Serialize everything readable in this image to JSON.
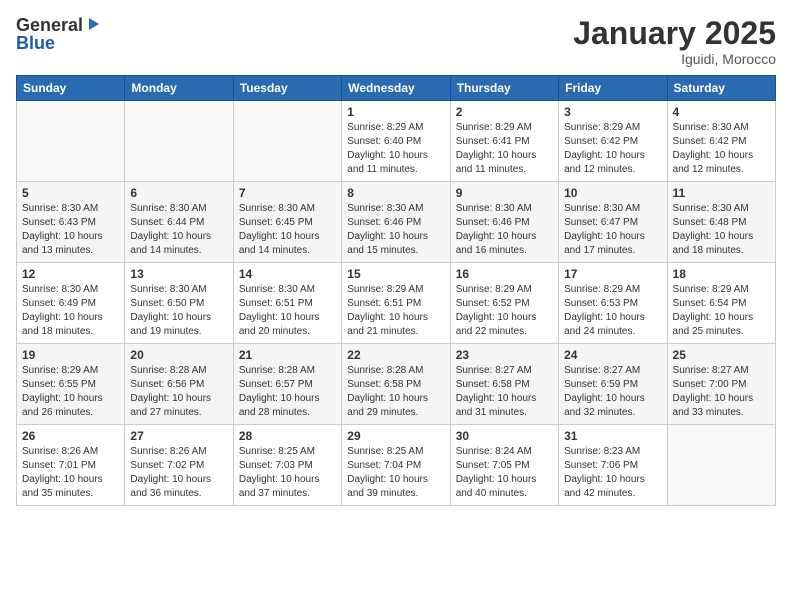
{
  "logo": {
    "general": "General",
    "blue": "Blue"
  },
  "title": {
    "month": "January 2025",
    "location": "Iguidi, Morocco"
  },
  "weekdays": [
    "Sunday",
    "Monday",
    "Tuesday",
    "Wednesday",
    "Thursday",
    "Friday",
    "Saturday"
  ],
  "weeks": [
    [
      {
        "day": "",
        "info": ""
      },
      {
        "day": "",
        "info": ""
      },
      {
        "day": "",
        "info": ""
      },
      {
        "day": "1",
        "info": "Sunrise: 8:29 AM\nSunset: 6:40 PM\nDaylight: 10 hours\nand 11 minutes."
      },
      {
        "day": "2",
        "info": "Sunrise: 8:29 AM\nSunset: 6:41 PM\nDaylight: 10 hours\nand 11 minutes."
      },
      {
        "day": "3",
        "info": "Sunrise: 8:29 AM\nSunset: 6:42 PM\nDaylight: 10 hours\nand 12 minutes."
      },
      {
        "day": "4",
        "info": "Sunrise: 8:30 AM\nSunset: 6:42 PM\nDaylight: 10 hours\nand 12 minutes."
      }
    ],
    [
      {
        "day": "5",
        "info": "Sunrise: 8:30 AM\nSunset: 6:43 PM\nDaylight: 10 hours\nand 13 minutes."
      },
      {
        "day": "6",
        "info": "Sunrise: 8:30 AM\nSunset: 6:44 PM\nDaylight: 10 hours\nand 14 minutes."
      },
      {
        "day": "7",
        "info": "Sunrise: 8:30 AM\nSunset: 6:45 PM\nDaylight: 10 hours\nand 14 minutes."
      },
      {
        "day": "8",
        "info": "Sunrise: 8:30 AM\nSunset: 6:46 PM\nDaylight: 10 hours\nand 15 minutes."
      },
      {
        "day": "9",
        "info": "Sunrise: 8:30 AM\nSunset: 6:46 PM\nDaylight: 10 hours\nand 16 minutes."
      },
      {
        "day": "10",
        "info": "Sunrise: 8:30 AM\nSunset: 6:47 PM\nDaylight: 10 hours\nand 17 minutes."
      },
      {
        "day": "11",
        "info": "Sunrise: 8:30 AM\nSunset: 6:48 PM\nDaylight: 10 hours\nand 18 minutes."
      }
    ],
    [
      {
        "day": "12",
        "info": "Sunrise: 8:30 AM\nSunset: 6:49 PM\nDaylight: 10 hours\nand 18 minutes."
      },
      {
        "day": "13",
        "info": "Sunrise: 8:30 AM\nSunset: 6:50 PM\nDaylight: 10 hours\nand 19 minutes."
      },
      {
        "day": "14",
        "info": "Sunrise: 8:30 AM\nSunset: 6:51 PM\nDaylight: 10 hours\nand 20 minutes."
      },
      {
        "day": "15",
        "info": "Sunrise: 8:29 AM\nSunset: 6:51 PM\nDaylight: 10 hours\nand 21 minutes."
      },
      {
        "day": "16",
        "info": "Sunrise: 8:29 AM\nSunset: 6:52 PM\nDaylight: 10 hours\nand 22 minutes."
      },
      {
        "day": "17",
        "info": "Sunrise: 8:29 AM\nSunset: 6:53 PM\nDaylight: 10 hours\nand 24 minutes."
      },
      {
        "day": "18",
        "info": "Sunrise: 8:29 AM\nSunset: 6:54 PM\nDaylight: 10 hours\nand 25 minutes."
      }
    ],
    [
      {
        "day": "19",
        "info": "Sunrise: 8:29 AM\nSunset: 6:55 PM\nDaylight: 10 hours\nand 26 minutes."
      },
      {
        "day": "20",
        "info": "Sunrise: 8:28 AM\nSunset: 6:56 PM\nDaylight: 10 hours\nand 27 minutes."
      },
      {
        "day": "21",
        "info": "Sunrise: 8:28 AM\nSunset: 6:57 PM\nDaylight: 10 hours\nand 28 minutes."
      },
      {
        "day": "22",
        "info": "Sunrise: 8:28 AM\nSunset: 6:58 PM\nDaylight: 10 hours\nand 29 minutes."
      },
      {
        "day": "23",
        "info": "Sunrise: 8:27 AM\nSunset: 6:58 PM\nDaylight: 10 hours\nand 31 minutes."
      },
      {
        "day": "24",
        "info": "Sunrise: 8:27 AM\nSunset: 6:59 PM\nDaylight: 10 hours\nand 32 minutes."
      },
      {
        "day": "25",
        "info": "Sunrise: 8:27 AM\nSunset: 7:00 PM\nDaylight: 10 hours\nand 33 minutes."
      }
    ],
    [
      {
        "day": "26",
        "info": "Sunrise: 8:26 AM\nSunset: 7:01 PM\nDaylight: 10 hours\nand 35 minutes."
      },
      {
        "day": "27",
        "info": "Sunrise: 8:26 AM\nSunset: 7:02 PM\nDaylight: 10 hours\nand 36 minutes."
      },
      {
        "day": "28",
        "info": "Sunrise: 8:25 AM\nSunset: 7:03 PM\nDaylight: 10 hours\nand 37 minutes."
      },
      {
        "day": "29",
        "info": "Sunrise: 8:25 AM\nSunset: 7:04 PM\nDaylight: 10 hours\nand 39 minutes."
      },
      {
        "day": "30",
        "info": "Sunrise: 8:24 AM\nSunset: 7:05 PM\nDaylight: 10 hours\nand 40 minutes."
      },
      {
        "day": "31",
        "info": "Sunrise: 8:23 AM\nSunset: 7:06 PM\nDaylight: 10 hours\nand 42 minutes."
      },
      {
        "day": "",
        "info": ""
      }
    ]
  ]
}
